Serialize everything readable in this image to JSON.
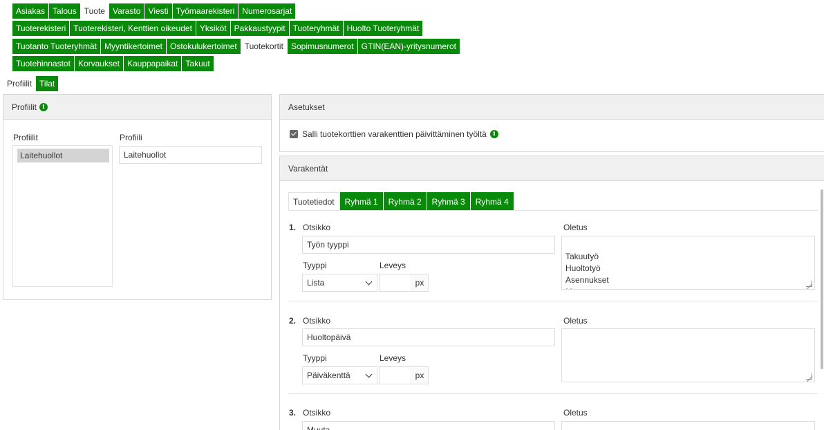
{
  "nav": {
    "row1": [
      "Asiakas",
      "Talous",
      "Tuote",
      "Varasto",
      "Viesti",
      "Työmaarekisteri",
      "Numerosarjat"
    ],
    "row2": [
      "Tuoterekisteri",
      "Tuoterekisteri, Kenttien oikeudet",
      "Yksiköt",
      "Pakkaustyypit",
      "Tuoteryhmät",
      "Huolto Tuoteryhmät"
    ],
    "row3": [
      "Tuotanto Tuoteryhmät",
      "Myyntikertoimet",
      "Ostokulukertoimet",
      "Tuotekortit",
      "Sopimusnumerot",
      "GTIN(EAN)-yritysnumerot"
    ],
    "row4": [
      "Tuotehinnastot",
      "Korvaukset",
      "Kauppapaikat",
      "Takuut"
    ],
    "active_row1": "Tuote",
    "active_row3": "Tuotekortit"
  },
  "subtabs": [
    "Profiilit",
    "Tilat"
  ],
  "subtabs_active": "Profiilit",
  "left_panel": {
    "title": "Profiilit",
    "list_label": "Profiilit",
    "list_items": [
      "Laitehuollot"
    ],
    "profile_label": "Profiili",
    "profile_value": "Laitehuollot"
  },
  "settings": {
    "title": "Asetukset",
    "checkbox_label": "Salli tuotekorttien varakenttien päivittäminen työltä",
    "checked": true
  },
  "varakentat": {
    "title": "Varakentät",
    "tabs": [
      "Tuotetiedot",
      "Ryhmä 1",
      "Ryhmä 2",
      "Ryhmä 3",
      "Ryhmä 4"
    ],
    "active_tab": "Tuotetiedot",
    "fields": [
      {
        "num": "1.",
        "otsikko_label": "Otsikko",
        "otsikko": "Työn tyyppi",
        "tyyppi_label": "Tyyppi",
        "tyyppi": "Lista",
        "leveys_label": "Leveys",
        "leveys": "",
        "unit": "px",
        "oletus_label": "Oletus",
        "oletus": "Takuutyö\nHuoltotyö\nAsennukset\nMuu"
      },
      {
        "num": "2.",
        "otsikko_label": "Otsikko",
        "otsikko": "Huoltopäivä",
        "tyyppi_label": "Tyyppi",
        "tyyppi": "Päiväkenttä",
        "leveys_label": "Leveys",
        "leveys": "",
        "unit": "px",
        "oletus_label": "Oletus",
        "oletus": ""
      },
      {
        "num": "3.",
        "otsikko_label": "Otsikko",
        "otsikko": "Muuta",
        "oletus_label": "Oletus"
      }
    ]
  },
  "colors": {
    "accent": "#0a8a0a"
  }
}
